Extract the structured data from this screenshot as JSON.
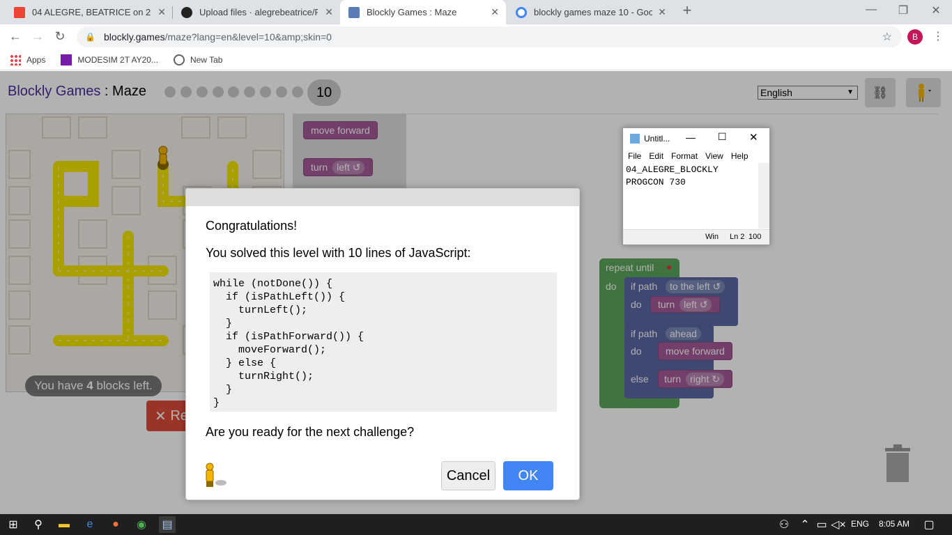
{
  "browser": {
    "tabs": [
      {
        "title": "04 ALEGRE, BEATRICE on 2019T2"
      },
      {
        "title": "Upload files · alegrebeatrice/PRO"
      },
      {
        "title": "Blockly Games : Maze"
      },
      {
        "title": "blockly games maze 10 - Google"
      }
    ],
    "new_tab": "+",
    "url_host": "blockly.games",
    "url_path": "/maze?lang=en&level=10&amp;skin=0",
    "profile_initial": "B",
    "bookmarks": [
      {
        "label": "Apps"
      },
      {
        "label": "MODESIM 2T AY20..."
      },
      {
        "label": "New Tab"
      }
    ]
  },
  "app": {
    "title_prefix": "Blockly Games",
    "title_sep": " : ",
    "title_game": "Maze",
    "level_number": "10",
    "language": "English",
    "blocks_left_prefix": "You have ",
    "blocks_left_count": "4",
    "blocks_left_suffix": " blocks left.",
    "reset_label": "Re",
    "toolbox": {
      "move_forward": "move forward",
      "turn": "turn",
      "turn_dir": "left ↺"
    },
    "workspace": {
      "repeat_until": "repeat until",
      "do": "do",
      "if_path": "if path",
      "to_the_left": "to the left ↺",
      "turn": "turn",
      "left": "left ↺",
      "ahead": "ahead",
      "move_forward": "move forward",
      "else": "else",
      "right": "right ↻"
    }
  },
  "dialog": {
    "congrats": "Congratulations!",
    "solved": "You solved this level with 10 lines of JavaScript:",
    "code_lines": [
      "while (notDone()) {",
      "  if (isPathLeft()) {",
      "    turnLeft();",
      "  }",
      "  if (isPathForward()) {",
      "    moveForward();",
      "  } else {",
      "    turnRight();",
      "  }",
      "}"
    ],
    "question": "Are you ready for the next challenge?",
    "cancel": "Cancel",
    "ok": "OK"
  },
  "notepad": {
    "title": "Untitl...",
    "menu": [
      "File",
      "Edit",
      "Format",
      "View",
      "Help"
    ],
    "text": "04_ALEGRE_BLOCKLY\nPROGCON 730",
    "status_enc": "Win",
    "status_pos": "Ln 2",
    "status_zoom": "100"
  },
  "taskbar": {
    "language": "ENG",
    "time": "8:05 AM"
  },
  "colors": {
    "accent": "#4285f4",
    "brand_purple": "#4a2d97",
    "block_purple": "#a55b99",
    "block_blue": "#5b67a5",
    "loop_green": "#5ba55b",
    "path_yellow": "#f2e600"
  }
}
